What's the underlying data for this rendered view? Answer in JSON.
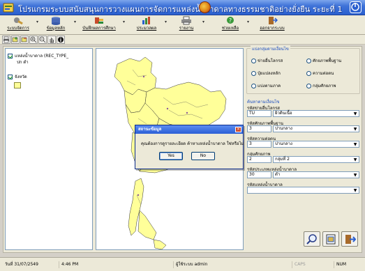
{
  "app": {
    "title": "โปรแกรมระบบสนับสนุนการวางแผนการจัดการแหล่งน้ำบาดาลทางธรรมชาติอย่างยั่งยืน ระยะที่ 1"
  },
  "menu": [
    {
      "label": "ระบบจัดการ",
      "icon": "tools-icon"
    },
    {
      "label": "ข้อมูลหลัก",
      "icon": "database-icon"
    },
    {
      "label": "บันทึกผลการศึกษา",
      "icon": "tools-icon"
    },
    {
      "label": "ประมวลผล",
      "icon": "chart-icon"
    },
    {
      "label": "รายงาน",
      "icon": "printer-icon"
    },
    {
      "label": "ช่วยเหลือ",
      "icon": "help-icon"
    },
    {
      "label": "ออกจากระบบ",
      "icon": "exit-icon"
    }
  ],
  "legend": {
    "layer_name": "แหล่งน้ำบาดาล (REC_TYPE_",
    "layer_sub": "ปก ดำ",
    "region_name": "จังหวัด"
  },
  "panel": {
    "group_title": "แบ่งกลุ่มตามเงื่อนไข",
    "radios": [
      "ข่ายอื่นโลกรส",
      "ศักยภาพพื้นฐาน",
      "ปุ๋ยแปลงหลัก",
      "ความต่อตน",
      "แบ่งตามภาค",
      "กลุ่มศักยภาพ"
    ],
    "condition_label": "ค้นหาตามเงื่อนไข",
    "fields": [
      {
        "label": "รหัสข่ายอื่นโลกรส",
        "code": "TU",
        "name": "ผิวดินเนื้อ"
      },
      {
        "label": "รหัสศักยภาพพื้นฐาน",
        "code": "3",
        "name": "ปานกลาง"
      },
      {
        "label": "รหัสความต่อตน",
        "code": "3",
        "name": "ปานกลาง"
      },
      {
        "label": "กลุ่มศักยภาพ",
        "code": "2",
        "name": "กลุ่มที่ 2"
      },
      {
        "label": "รหัสประเภทแหล่งน้ำบาดาล",
        "code": "30",
        "name": "ดำ"
      },
      {
        "label": "รหัสแหล่งน้ำบาดาล",
        "code": "",
        "name": ""
      }
    ]
  },
  "dialog": {
    "title": "สถานะข้อมูล",
    "message": "คุณต้องการดูรายละเอียด ค้าหาแหล่งน้ำบาดาล ใช่หรือไม่",
    "yes_label": "Yes",
    "no_label": "No"
  },
  "status": {
    "date": "วันที่ 31/07/2549",
    "time": "4:46 PM",
    "user": "ผู้ใช้ระบบ admin",
    "caps": "CAPS",
    "num": "NUM"
  },
  "colors": {
    "titlebar": "#2a5fcf",
    "map_fill": "#ffff99",
    "panel_bg": "#ece9d8"
  }
}
